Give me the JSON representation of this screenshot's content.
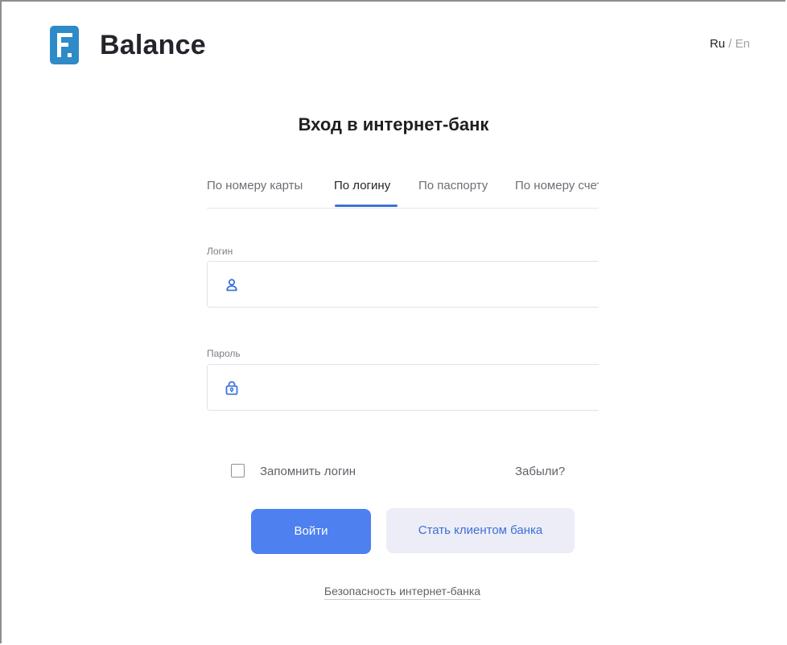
{
  "header": {
    "brand": "Balance",
    "lang_ru": "Ru",
    "lang_sep": " / ",
    "lang_en": "En"
  },
  "main": {
    "title": "Вход в интернет-банк",
    "tabs": [
      {
        "label": "По номеру карты",
        "active": false
      },
      {
        "label": "По логину",
        "active": true
      },
      {
        "label": "По паспорту",
        "active": false
      },
      {
        "label": "По номеру счета",
        "active": false
      }
    ],
    "login": {
      "label": "Логин",
      "value": "",
      "icon": "user-icon"
    },
    "password": {
      "label": "Пароль",
      "value": "",
      "icon": "lock-icon"
    },
    "remember_label": "Запомнить логин",
    "remember_checked": false,
    "forgot_label": "Забыли?",
    "login_button": "Войти",
    "become_client_button": "Стать клиентом банка",
    "security_link": "Безопасность интернет-банка"
  },
  "colors": {
    "brand": "#2e8bc7",
    "accent": "#4e80ef",
    "secondary_bg": "#ecedf6",
    "secondary_text": "#3e6fd8"
  }
}
